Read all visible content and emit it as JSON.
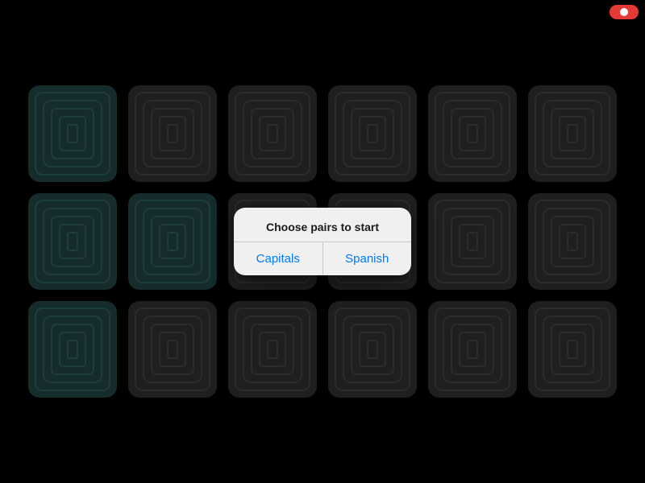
{
  "app": {
    "background": "#000000"
  },
  "record_indicator": {
    "visible": true
  },
  "grid": {
    "rows": 3,
    "cols": 6,
    "total_cards": 18,
    "teal_indices": [
      0,
      6,
      7,
      12
    ]
  },
  "dialog": {
    "title": "Choose pairs to start",
    "buttons": [
      {
        "label": "Capitals",
        "id": "capitals"
      },
      {
        "label": "Spanish",
        "id": "spanish"
      }
    ]
  }
}
